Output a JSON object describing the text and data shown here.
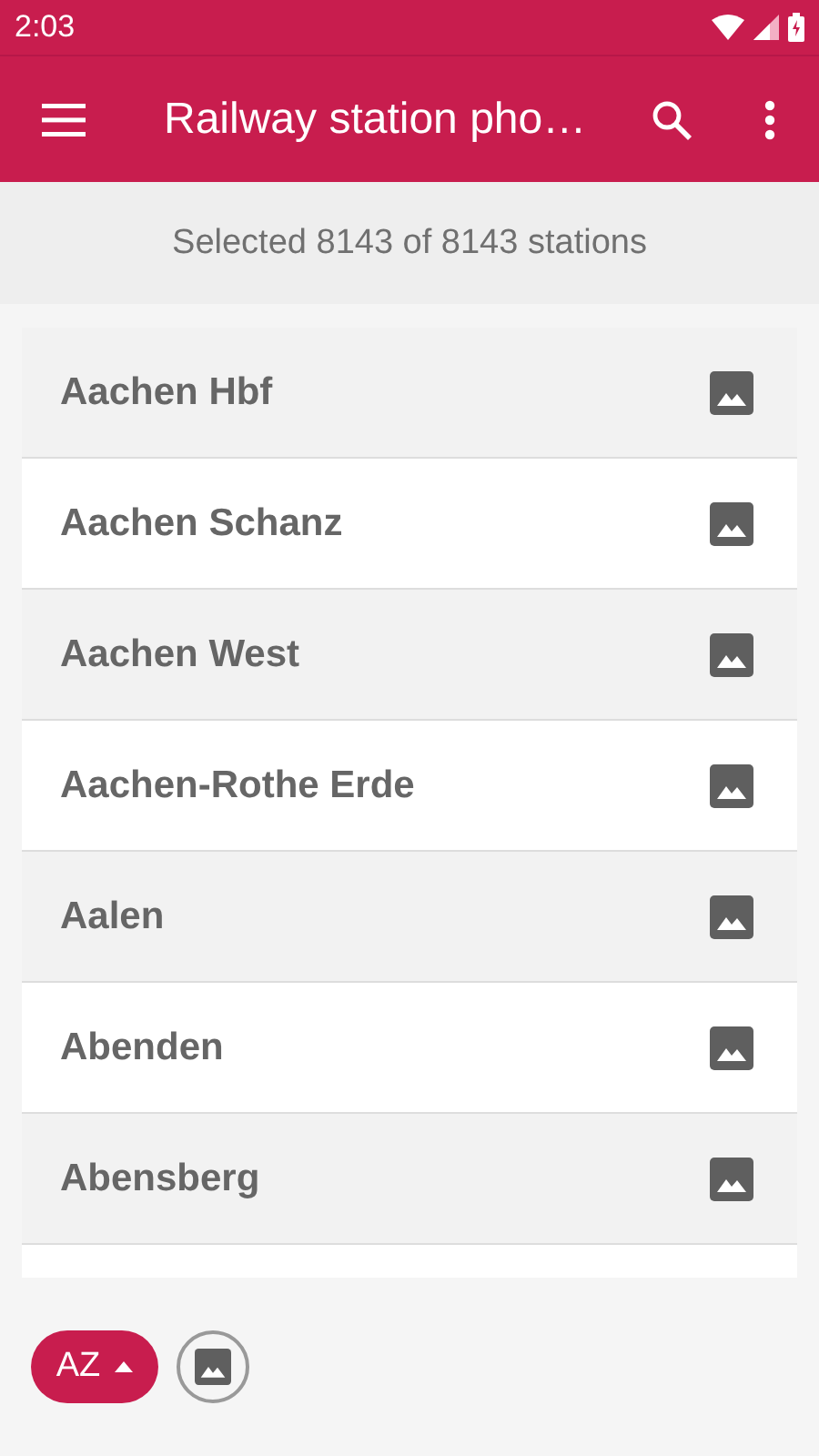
{
  "status_bar": {
    "time": "2:03"
  },
  "app_bar": {
    "title": "Railway station pho…"
  },
  "summary": "Selected 8143 of 8143 stations",
  "stations": [
    {
      "name": "Aachen Hbf"
    },
    {
      "name": "Aachen Schanz"
    },
    {
      "name": "Aachen West"
    },
    {
      "name": "Aachen-Rothe Erde"
    },
    {
      "name": "Aalen"
    },
    {
      "name": "Abenden"
    },
    {
      "name": "Abensberg"
    }
  ],
  "sort_chip": {
    "label": "AZ"
  }
}
